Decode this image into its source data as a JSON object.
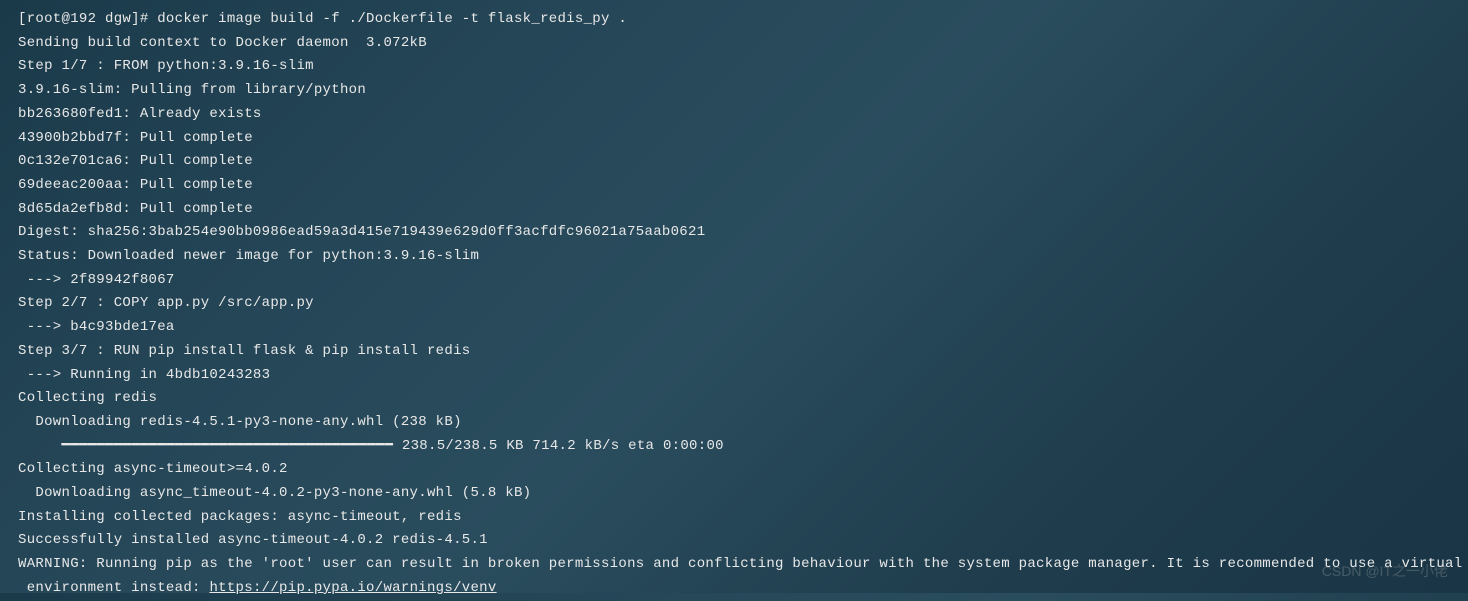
{
  "terminal": {
    "lines": [
      "[root@192 dgw]# docker image build -f ./Dockerfile -t flask_redis_py .",
      "Sending build context to Docker daemon  3.072kB",
      "Step 1/7 : FROM python:3.9.16-slim",
      "3.9.16-slim: Pulling from library/python",
      "bb263680fed1: Already exists",
      "43900b2bbd7f: Pull complete",
      "0c132e701ca6: Pull complete",
      "69deeac200aa: Pull complete",
      "8d65da2efb8d: Pull complete",
      "Digest: sha256:3bab254e90bb0986ead59a3d415e719439e629d0ff3acfdfc96021a75aab0621",
      "Status: Downloaded newer image for python:3.9.16-slim",
      " ---> 2f89942f8067",
      "Step 2/7 : COPY app.py /src/app.py",
      " ---> b4c93bde17ea",
      "Step 3/7 : RUN pip install flask & pip install redis",
      " ---> Running in 4bdb10243283",
      "Collecting redis",
      "  Downloading redis-4.5.1-py3-none-any.whl (238 kB)",
      "     ━━━━━━━━━━━━━━━━━━━━━━━━━━━━━━━━━━━━━━ 238.5/238.5 KB 714.2 kB/s eta 0:00:00",
      "Collecting async-timeout>=4.0.2",
      "  Downloading async_timeout-4.0.2-py3-none-any.whl (5.8 kB)",
      "Installing collected packages: async-timeout, redis",
      "Successfully installed async-timeout-4.0.2 redis-4.5.1",
      "WARNING: Running pip as the 'root' user can result in broken permissions and conflicting behaviour with the system package manager. It is recommended to use a virtual"
    ],
    "last_line_prefix": " environment instead: ",
    "last_line_url": "https://pip.pypa.io/warnings/venv"
  },
  "watermark": "CSDN @IT之一小佬"
}
